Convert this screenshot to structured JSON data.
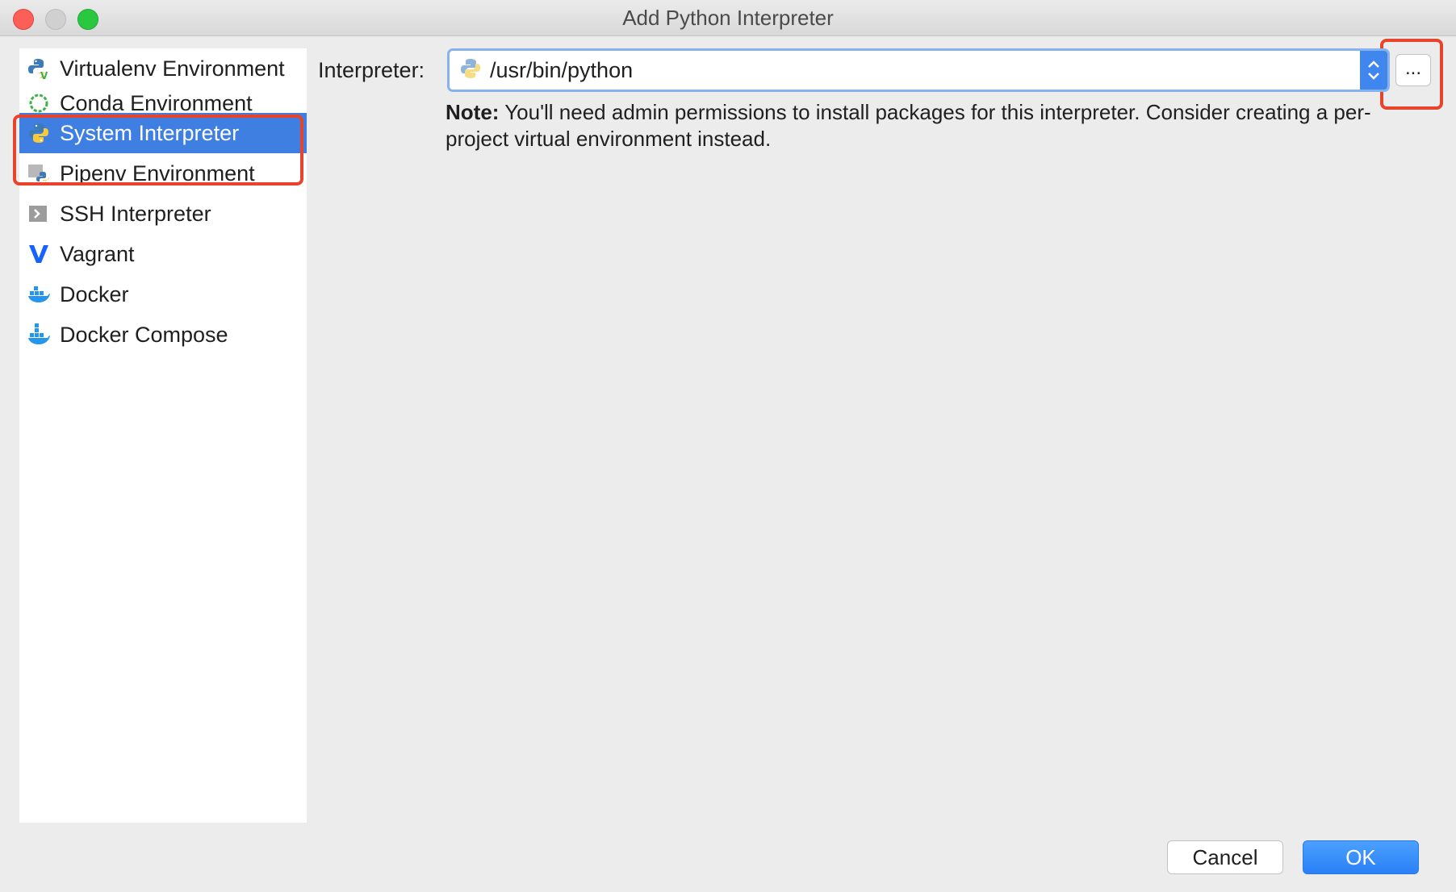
{
  "window": {
    "title": "Add Python Interpreter"
  },
  "sidebar": {
    "items": [
      {
        "label": "Virtualenv Environment",
        "icon": "virtualenv-icon",
        "selected": false
      },
      {
        "label": "Conda Environment",
        "icon": "conda-icon",
        "selected": false
      },
      {
        "label": "System Interpreter",
        "icon": "python-icon",
        "selected": true
      },
      {
        "label": "Pipenv Environment",
        "icon": "pipenv-icon",
        "selected": false
      },
      {
        "label": "SSH Interpreter",
        "icon": "ssh-icon",
        "selected": false
      },
      {
        "label": "Vagrant",
        "icon": "vagrant-icon",
        "selected": false
      },
      {
        "label": "Docker",
        "icon": "docker-icon",
        "selected": false
      },
      {
        "label": "Docker Compose",
        "icon": "docker-compose-icon",
        "selected": false
      }
    ]
  },
  "main": {
    "interpreter_label": "Interpreter:",
    "interpreter_value": "/usr/bin/python",
    "browse_label": "...",
    "note_bold": "Note:",
    "note_text": " You'll need admin permissions to install packages for this interpreter. Consider creating a per-project virtual environment instead."
  },
  "buttons": {
    "cancel": "Cancel",
    "ok": "OK"
  },
  "colors": {
    "selection": "#3f7fe1",
    "highlight": "#e8432b",
    "primary_button": "#2a80f5"
  }
}
